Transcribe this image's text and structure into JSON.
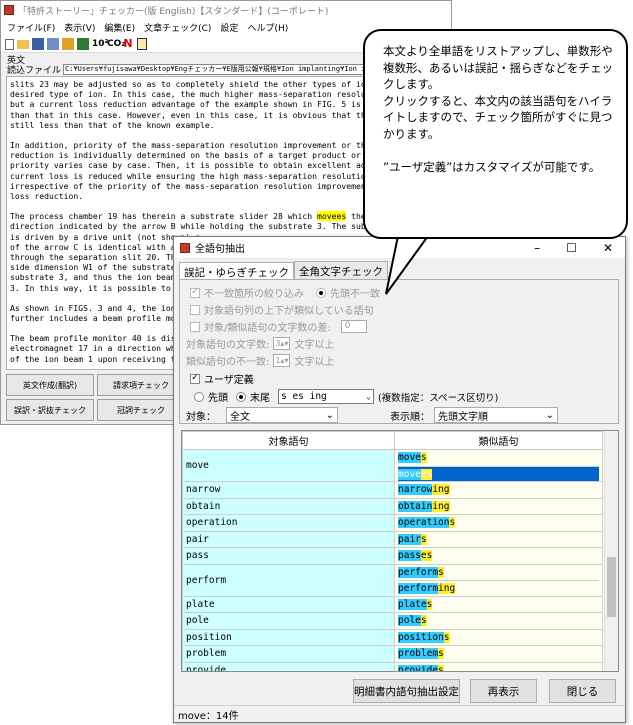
{
  "main": {
    "title": "「特許ストーリー」チェッカー(版 English)【スタンダード】(コーポレート)",
    "menu": [
      "ファイル(F)",
      "表示(V)",
      "編集(E)",
      "文章チェック(C)",
      "設定",
      "ヘルプ(H)"
    ],
    "language_label": "英文",
    "file_label": "読込ファイル",
    "file_path": "C:¥Users¥fujisawa¥Desktop¥Engチェッカー¥E版用公報¥規格¥Ion implanting¥Ion implant",
    "paragraphs": [
      [
        {
          "t": "slits 23 may be adjusted so as to completely shield the other types of ions except",
          "h": false
        },
        {
          "t": "desired type of ion. In this case, the much higher mass-separation resolution is o",
          "h": false
        },
        {
          "t": "but a current loss reduction advantage of the example shown in FIG. 5 is slightly",
          "h": false
        },
        {
          "t": "than that in this case. However, even in this case, it is obvious that the current",
          "h": false
        },
        {
          "t": "still less than that of the known example.",
          "h": false
        }
      ],
      [
        {
          "t": "In addition, priority of the mass-separation resolution improvement or the current",
          "h": false
        },
        {
          "t": "reduction is individually determined on the basis of a target product or a user, a",
          "h": false
        },
        {
          "t": "priority varies case by case. Then, it is possible to obtain excellent advantage t",
          "h": false
        },
        {
          "t": "current loss is reduced while ensuring the high mass-separation resolution all the",
          "h": false
        },
        {
          "t": "irrespective of the priority of the mass-separation resolution improvement or the",
          "h": false
        },
        {
          "t": "loss reduction.",
          "h": false
        }
      ],
      [
        {
          "t": "The process chamber 19 has therein a substrate slider 28 which ",
          "h": false,
          "hl": "movees",
          "after": " the substrat"
        },
        {
          "t": "direction indicated by the arrow B while holding the substrate 3. The substrate sli",
          "h": false
        },
        {
          "t": "is driven by a drive unit (not shown) s",
          "h": false
        },
        {
          "t": "of the arrow C is identical with a thic",
          "h": false
        },
        {
          "t": "through the separation slit 20. Then, t",
          "h": false
        },
        {
          "t": "side dimension W1 of the substrate 3 is",
          "h": false
        },
        {
          "t": "substrate 3, and thus the ion beam 1 is",
          "h": false
        },
        {
          "t": "3. In this way, it is possible to perfo",
          "h": false
        }
      ],
      [
        {
          "t": "As shown in FIGS. 3 and 4, the ion impl",
          "h": false
        },
        {
          "t": "further includes a beam profile monitor",
          "h": false
        }
      ],
      [
        {
          "t": "The beam profile monitor 40 is disposed",
          "h": false
        },
        {
          "t": "electromagnet 17 in a direction where t",
          "h": false
        },
        {
          "t": "of the ion beam 1 upon receiving the io",
          "h": false
        }
      ]
    ],
    "buttons": [
      "英文作成(翻訳)",
      "請求項チェック",
      "",
      "誤訳・訳抜チェック",
      "冠詞チェック",
      ""
    ]
  },
  "callout": {
    "lines": [
      "本文より全単語をリストアップし、単数形や複数形、あるいは誤記・揺らぎなどをチェックします。",
      "クリックすると、本文内の該当語句をハイライトしますので、チェック箇所がすぐに見つかります。",
      "",
      "”ユーザ定義”はカスタマイズが可能です。"
    ]
  },
  "dialog": {
    "title": "全語句抽出",
    "tabs": [
      "誤記・ゆらぎチェック",
      "全角文字チェック"
    ],
    "opt_narrow": "不一致箇所の絞り込み",
    "opt_head_mismatch": "先頭不一致",
    "opt_adjacent": "対象語句列の上下が類似している語句",
    "opt_char_diff": "対象/類似語句の文字数の差:",
    "char_diff_value": "0",
    "min_chars_label": "対象語句の文字数:",
    "min_chars_value": "3",
    "min_chars_suffix": "文字以上",
    "mismatch_label": "類似語句の不一致:",
    "mismatch_value": "1",
    "mismatch_suffix": "文字以上",
    "user_def_label": "ユーザ定義",
    "radio_head": "先頭",
    "radio_tail": "末尾",
    "suffix_value": "s es ing",
    "suffix_note": "(複数指定：スペース区切り)",
    "target_label": "対象：",
    "target_value": "全文",
    "order_label": "表示順：",
    "order_value": "先頭文字順",
    "col_target": "対象語句",
    "col_similar": "類似語句",
    "rows": [
      {
        "target": "move",
        "similar": [
          {
            "pre": "",
            "c": "move",
            "y": "s",
            "sel": false
          },
          {
            "pre": "",
            "c": "move",
            "y": "es",
            "sel": true
          }
        ]
      },
      {
        "target": "narrow",
        "similar": [
          {
            "c": "narrow",
            "y": "ing"
          }
        ]
      },
      {
        "target": "obtain",
        "similar": [
          {
            "c": "obtain",
            "y": "ing"
          }
        ]
      },
      {
        "target": "operation",
        "similar": [
          {
            "c": "operation",
            "y": "s"
          }
        ]
      },
      {
        "target": "pair",
        "similar": [
          {
            "c": "pair",
            "y": "s"
          }
        ]
      },
      {
        "target": "pass",
        "similar": [
          {
            "c": "pass",
            "y": "es"
          }
        ]
      },
      {
        "target": "perform",
        "similar": [
          {
            "c": "perform",
            "y": "s"
          },
          {
            "c": "perform",
            "y": "ing"
          }
        ]
      },
      {
        "target": "plate",
        "similar": [
          {
            "c": "plate",
            "y": "s"
          }
        ]
      },
      {
        "target": "pole",
        "similar": [
          {
            "c": "pole",
            "y": "s"
          }
        ]
      },
      {
        "target": "position",
        "similar": [
          {
            "c": "position",
            "y": "s"
          }
        ]
      },
      {
        "target": "problem",
        "similar": [
          {
            "c": "problem",
            "y": "s"
          }
        ]
      },
      {
        "target": "provide",
        "similar": [
          {
            "c": "provide",
            "y": "s"
          }
        ]
      }
    ],
    "btn_spec": "明細書内語句抽出設定",
    "btn_refresh": "再表示",
    "btn_close": "閉じる",
    "status": "move：14件"
  },
  "colors": {
    "highlight_yellow": "#ffff00",
    "cyan": "#33ccff",
    "selection": "#0066cc",
    "col_target_bg": "#ccffff"
  }
}
